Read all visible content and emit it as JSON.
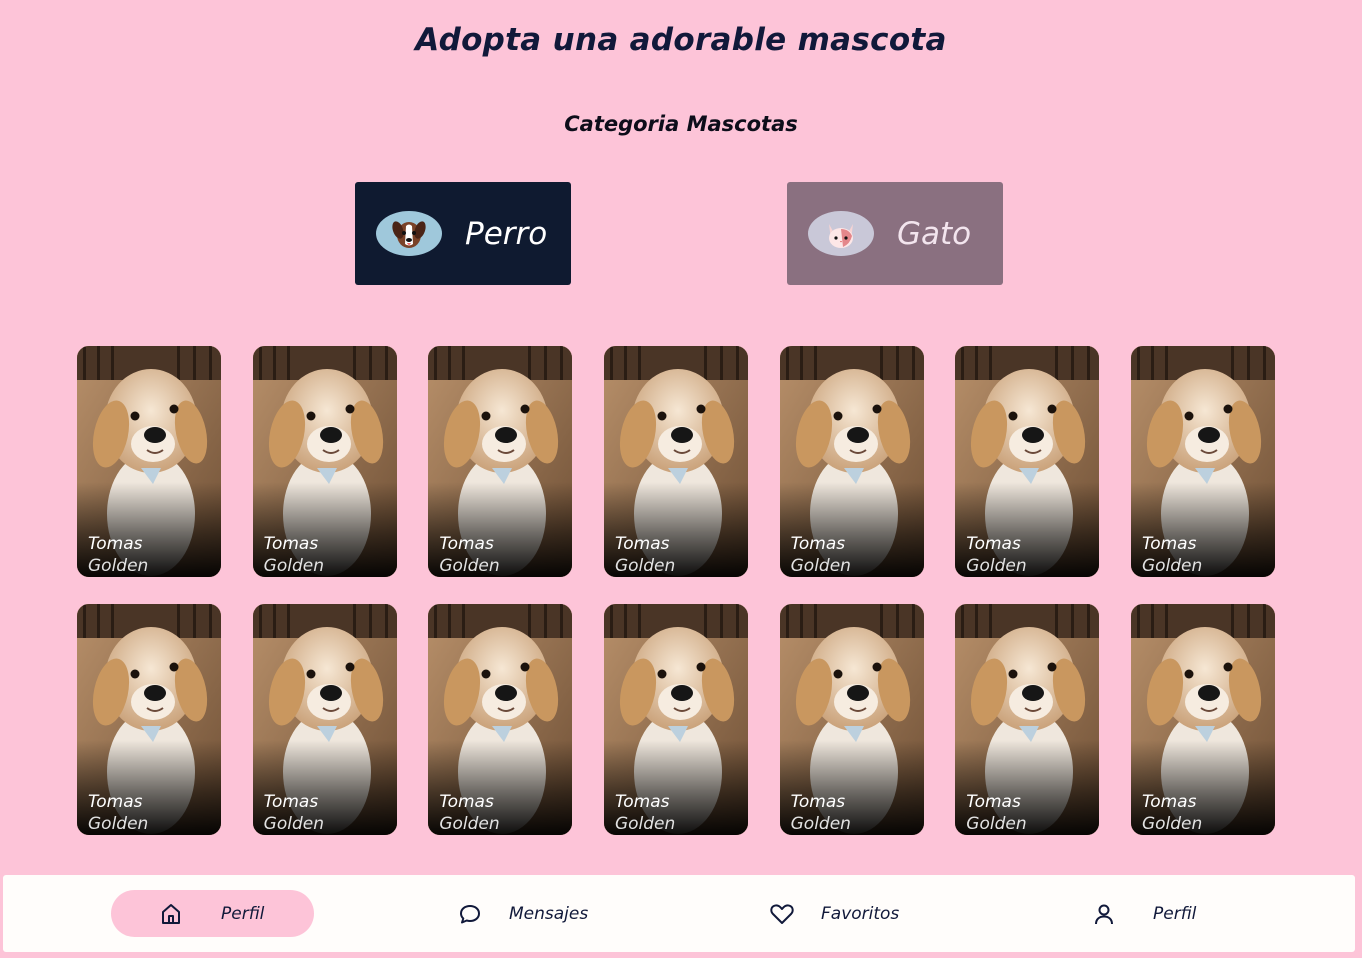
{
  "page": {
    "title": "Adopta una adorable mascota",
    "subtitle": "Categoria Mascotas"
  },
  "categories": [
    {
      "label": "Perro",
      "icon": "dog-icon",
      "selected": true
    },
    {
      "label": "Gato",
      "icon": "cat-icon",
      "selected": false
    }
  ],
  "pets": [
    {
      "name": "Tomas",
      "breed": "Golden"
    },
    {
      "name": "Tomas",
      "breed": "Golden"
    },
    {
      "name": "Tomas",
      "breed": "Golden"
    },
    {
      "name": "Tomas",
      "breed": "Golden"
    },
    {
      "name": "Tomas",
      "breed": "Golden"
    },
    {
      "name": "Tomas",
      "breed": "Golden"
    },
    {
      "name": "Tomas",
      "breed": "Golden"
    },
    {
      "name": "Tomas",
      "breed": "Golden"
    },
    {
      "name": "Tomas",
      "breed": "Golden"
    },
    {
      "name": "Tomas",
      "breed": "Golden"
    },
    {
      "name": "Tomas",
      "breed": "Golden"
    },
    {
      "name": "Tomas",
      "breed": "Golden"
    },
    {
      "name": "Tomas",
      "breed": "Golden"
    },
    {
      "name": "Tomas",
      "breed": "Golden"
    }
  ],
  "nav": {
    "items": [
      {
        "label": "Perfil",
        "icon": "home-icon",
        "active": true
      },
      {
        "label": "Mensajes",
        "icon": "chat-icon",
        "active": false
      },
      {
        "label": "Favoritos",
        "icon": "heart-icon",
        "active": false
      },
      {
        "label": "Perfil",
        "icon": "user-icon",
        "active": false
      }
    ]
  },
  "colors": {
    "background": "#fdc4d8",
    "dog_button": "#0f1a30",
    "cat_button": "#8a7080",
    "navbar": "#fffdfb",
    "active_nav": "#fdc4d8",
    "text_dark": "#11193a"
  }
}
